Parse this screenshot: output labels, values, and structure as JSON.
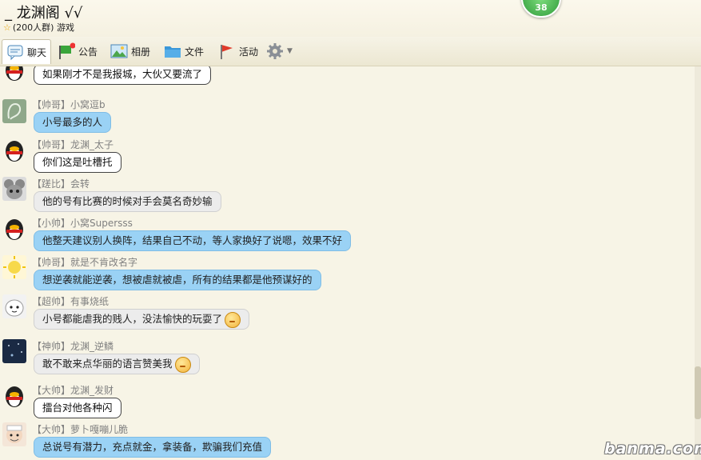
{
  "group": {
    "title": "_  龙渊阁  √√",
    "subtitle": "(200人群) 游戏",
    "badge_count": "38"
  },
  "toolbar": {
    "chat": "聊天",
    "notice": "公告",
    "album": "相册",
    "files": "文件",
    "activity": "活动"
  },
  "messages": [
    {
      "sender": "",
      "text": "如果刚才不是我报城，大伙又要流了",
      "style": "white"
    },
    {
      "sender": "【帅哥】小窝逗b",
      "text": "小号最多的人",
      "style": "blue"
    },
    {
      "sender": "【帅哥】龙渊_太子",
      "text": "你们这是吐槽托",
      "style": "white"
    },
    {
      "sender": "【蹉比】会转",
      "text": "他的号有比赛的时候对手会莫名奇妙输",
      "style": "grey"
    },
    {
      "sender": "【小帅】小窝Supersss",
      "text": "他整天建议别人换阵，结果自己不动，等人家换好了说嗯，效果不好",
      "style": "blue"
    },
    {
      "sender": "【帅哥】就是不肯改名字",
      "text": "想逆袭就能逆袭，想被虐就被虐，所有的结果都是他预谋好的",
      "style": "blue"
    },
    {
      "sender": "【超帅】有事烧纸",
      "text": "小号都能虐我的贱人，没法愉快的玩耍了",
      "style": "grey"
    },
    {
      "sender": "【神帅】龙渊_逆鳞",
      "text": "敢不敢来点华丽的语言赞美我",
      "style": "grey"
    },
    {
      "sender": "【大帅】龙渊_发财",
      "text": "擂台对他各种闪",
      "style": "white"
    },
    {
      "sender": "【大帅】萝卜嘎嘣儿脆",
      "text": "总说号有潜力，充点就金，拿装备，欺骗我们充值",
      "style": "blue"
    }
  ],
  "watermark": "banma.com",
  "colors": {
    "blue_bubble": "#9ad2f5",
    "grey_bubble": "#ececec",
    "white_bubble": "#ffffff"
  }
}
